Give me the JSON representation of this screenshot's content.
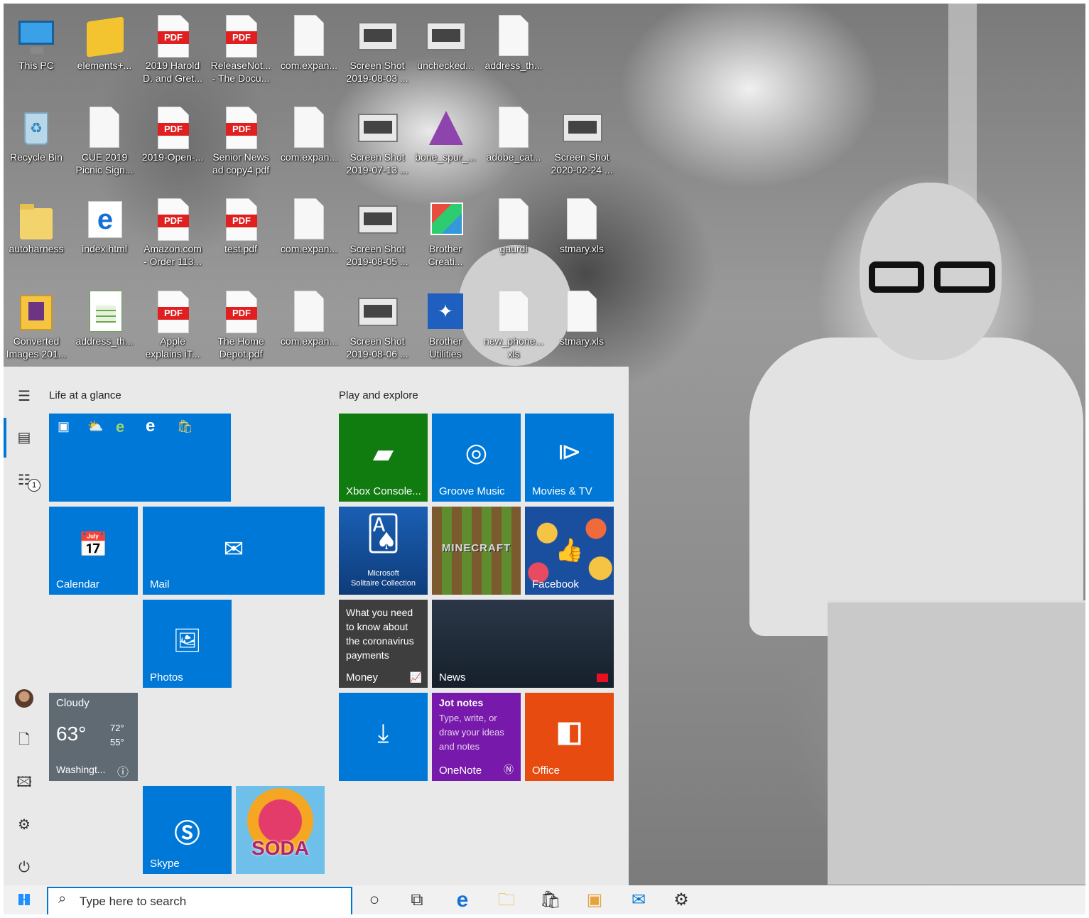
{
  "desktop": {
    "icons": [
      {
        "label": "This PC",
        "icon": "computer-icon"
      },
      {
        "label": "elements+...",
        "icon": "elements-icon"
      },
      {
        "label": "2019 Harold\nD. and Gret...",
        "icon": "pdf-icon"
      },
      {
        "label": "ReleaseNot...\n- The Docu...",
        "icon": "pdf-icon"
      },
      {
        "label": "com.expan...",
        "icon": "document-icon"
      },
      {
        "label": "Screen Shot\n2019-08-03 ...",
        "icon": "image-icon"
      },
      {
        "label": "unchecked...",
        "icon": "image-icon"
      },
      {
        "label": "address_th...",
        "icon": "document-icon"
      },
      {
        "label": "Recycle Bin",
        "icon": "recycle-bin-icon"
      },
      {
        "label": "CUE 2019\nPicnic Sign...",
        "icon": "document-icon"
      },
      {
        "label": "2019-Open-...",
        "icon": "pdf-icon"
      },
      {
        "label": "Senior News\nad copy4.pdf",
        "icon": "pdf-icon"
      },
      {
        "label": "com.expan...",
        "icon": "document-icon"
      },
      {
        "label": "Screen Shot\n2019-07-13 ...",
        "icon": "image-icon"
      },
      {
        "label": "bone_spur_...",
        "icon": "affinity-photo-icon"
      },
      {
        "label": "adobe_cat...",
        "icon": "document-icon"
      },
      {
        "label": "Screen Shot\n2020-02-24 ...",
        "icon": "image-icon"
      },
      {
        "label": "autoharness",
        "icon": "folder-icon"
      },
      {
        "label": "index.html",
        "icon": "edge-html-icon"
      },
      {
        "label": "Amazon.com\n- Order 113...",
        "icon": "pdf-icon"
      },
      {
        "label": "test.pdf",
        "icon": "pdf-icon"
      },
      {
        "label": "com.expan...",
        "icon": "document-icon"
      },
      {
        "label": "Screen Shot\n2019-08-05 ...",
        "icon": "image-icon"
      },
      {
        "label": "Brother\nCreati...",
        "icon": "brother-creative-icon"
      },
      {
        "label": "gaurdi",
        "icon": "document-icon"
      },
      {
        "label": "stmary.xls",
        "icon": "document-icon"
      },
      {
        "label": "Converted\nImages 201...",
        "icon": "package-icon"
      },
      {
        "label": "address_th...",
        "icon": "spreadsheet-icon"
      },
      {
        "label": "Apple\nexplains iT...",
        "icon": "pdf-icon"
      },
      {
        "label": "The Home\nDepot.pdf",
        "icon": "pdf-icon"
      },
      {
        "label": "com.expan...",
        "icon": "document-icon"
      },
      {
        "label": "Screen Shot\n2019-08-06 ...",
        "icon": "image-icon"
      },
      {
        "label": "Brother\nUtilities",
        "icon": "brother-utilities-icon"
      },
      {
        "label": "new_phone...\nxls",
        "icon": "document-icon"
      },
      {
        "label": "stmary.xls",
        "icon": "document-icon"
      }
    ]
  },
  "start_menu": {
    "groups": {
      "life": "Life at a glance",
      "play": "Play and explore"
    },
    "tiles": {
      "calendar": "Calendar",
      "mail": "Mail",
      "photos": "Photos",
      "skype": "Skype",
      "xbox": "Xbox Console...",
      "groove": "Groove Music",
      "movies": "Movies & TV",
      "solitaire_line1": "Microsoft",
      "solitaire_line2": "Solitaire Collection",
      "minecraft": "MINECRAFT",
      "facebook": "Facebook",
      "money_headline": "What you need to know about the coronavirus payments",
      "money": "Money",
      "news": "News",
      "onenote_title": "Jot notes",
      "onenote_body": "Type, write, or draw your ideas and notes",
      "onenote": "OneNote",
      "office": "Office",
      "candy": "SODA"
    },
    "weather": {
      "condition": "Cloudy",
      "temp": "63°",
      "high": "72°",
      "low": "55°",
      "location": "Washingt..."
    },
    "live_folder_badge": "1"
  },
  "taskbar": {
    "search_placeholder": "Type here to search"
  },
  "colors": {
    "accent": "#0078d7",
    "xbox": "#107c10",
    "onenote": "#7719aa",
    "office": "#e74b0f"
  }
}
